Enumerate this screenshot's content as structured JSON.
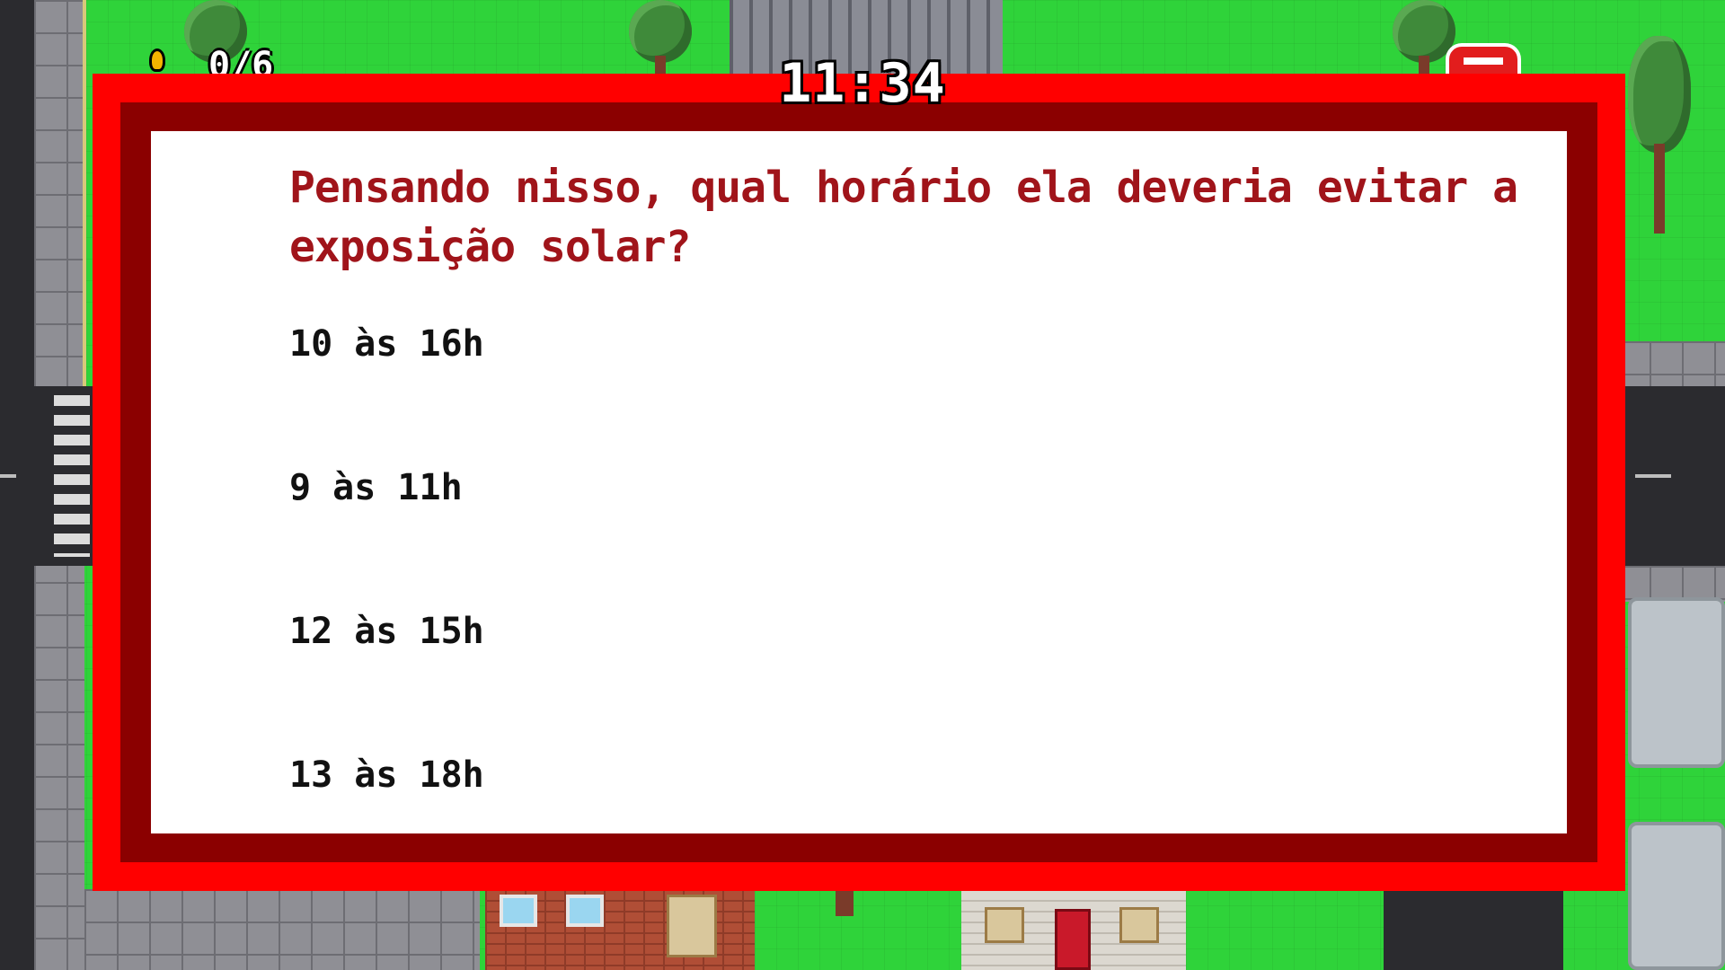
{
  "hud": {
    "timer": "11:34",
    "score": "0/6",
    "flame_icon": "flame-icon",
    "exit_icon": "exit-icon"
  },
  "quiz": {
    "question": "Pensando nisso, qual horário ela deveria evitar a exposição solar?",
    "options": [
      {
        "label": "10 às 16h"
      },
      {
        "label": "9 às 11h"
      },
      {
        "label": "12 às 15h"
      },
      {
        "label": "13 às 18h"
      }
    ]
  },
  "colors": {
    "modal_border_outer": "#ff0000",
    "modal_border_inner": "#8b0000",
    "question_text": "#a0141a",
    "option_text": "#111111",
    "grass": "#2fd33a"
  }
}
